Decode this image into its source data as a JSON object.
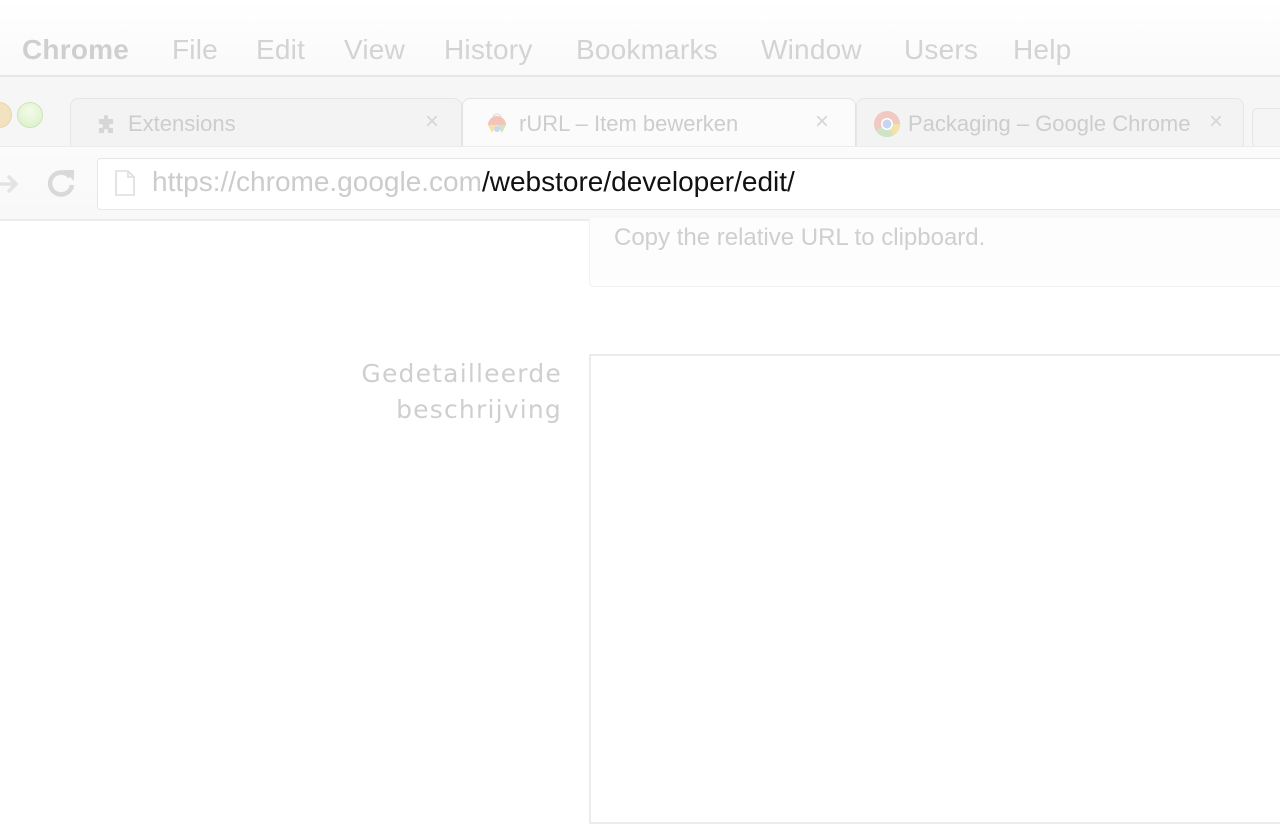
{
  "menubar": {
    "app_name": "Chrome",
    "items": [
      "File",
      "Edit",
      "View",
      "History",
      "Bookmarks",
      "Window",
      "Users",
      "Help"
    ]
  },
  "tabs": [
    {
      "title": "Extensions",
      "icon": "puzzle-piece-icon",
      "active": false
    },
    {
      "title": "rURL – Item bewerken",
      "icon": "webstore-icon",
      "active": true
    },
    {
      "title": "Packaging – Google Chrome",
      "icon": "chrome-logo-icon",
      "active": false
    }
  ],
  "tab_close_glyph": "×",
  "toolbar": {
    "url_host": "https://chrome.google.com",
    "url_path": "/webstore/developer/edit/"
  },
  "page": {
    "hint_text": "Copy the relative URL to clipboard.",
    "description_label_line1": "Gedetailleerde",
    "description_label_line2": "beschrijving",
    "description_value": ""
  },
  "colors": {
    "menu_text": "#d3d3d3",
    "url_path": "#111111",
    "url_host": "#cccccc",
    "traffic_green": "#d9efc4"
  }
}
